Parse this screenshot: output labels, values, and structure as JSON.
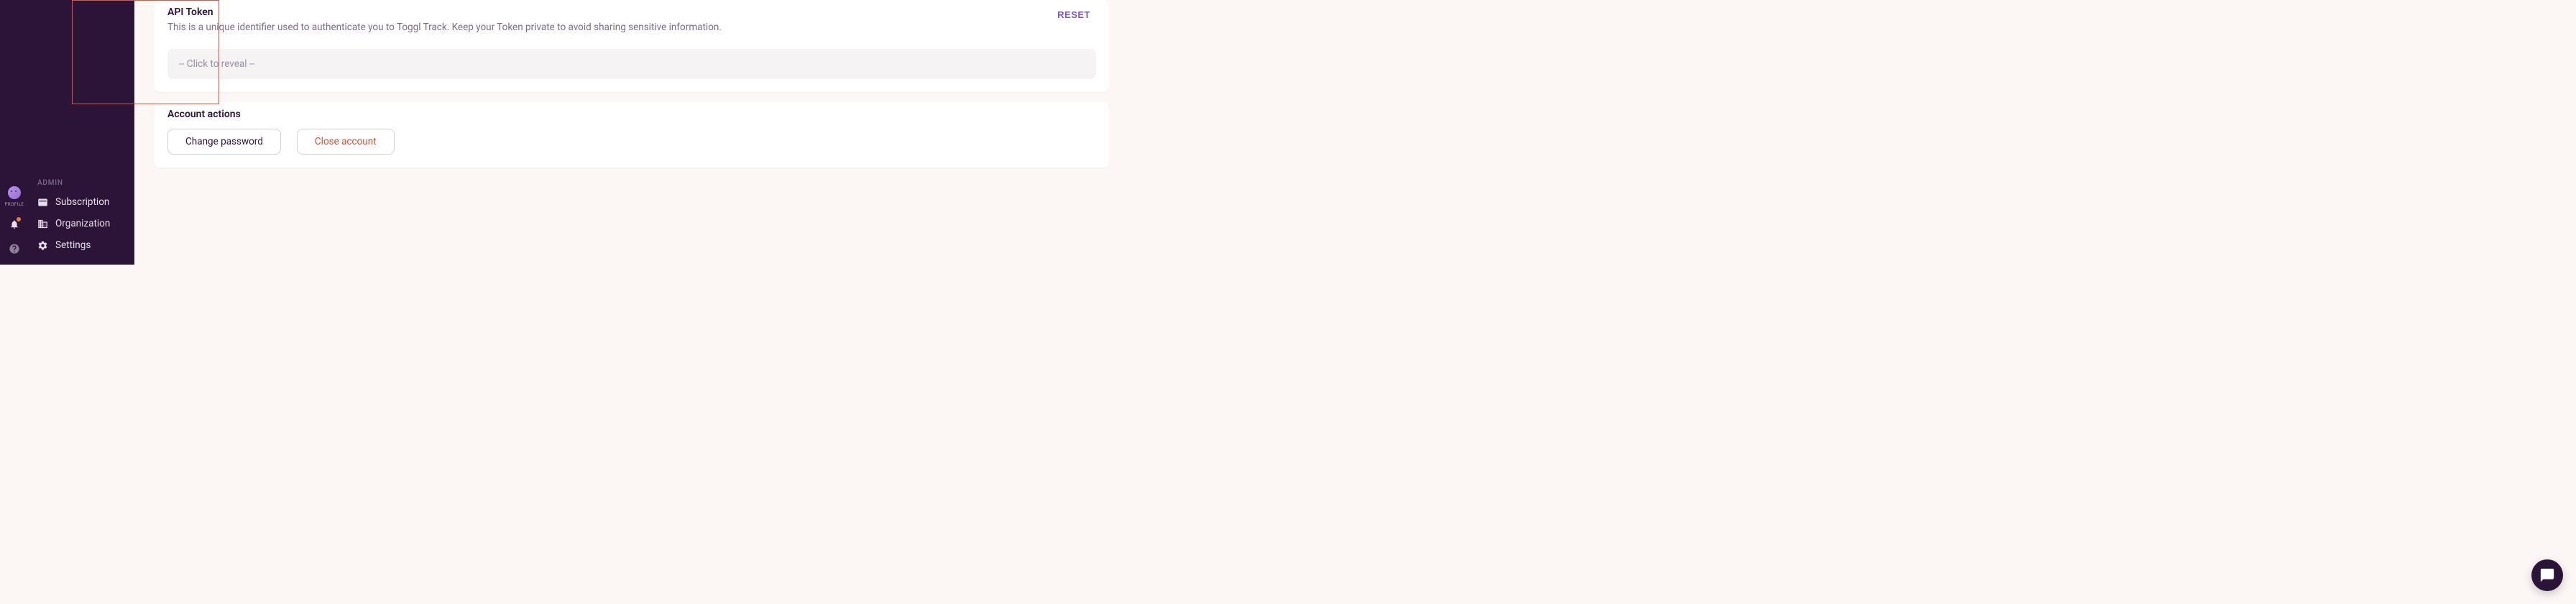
{
  "narrow_sidebar": {
    "profile_label": "PROFILE"
  },
  "wide_sidebar": {
    "admin_label": "ADMIN",
    "items": {
      "subscription": "Subscription",
      "organization": "Organization",
      "settings": "Settings"
    }
  },
  "api_token_card": {
    "title": "API Token",
    "description": "This is a unique identifier used to authenticate you to Toggl Track. Keep your Token private to avoid sharing sensitive information.",
    "reset_label": "RESET",
    "reveal_placeholder": "-- Click to reveal --"
  },
  "actions_card": {
    "title": "Account actions",
    "change_password_label": "Change password",
    "close_account_label": "Close account"
  }
}
